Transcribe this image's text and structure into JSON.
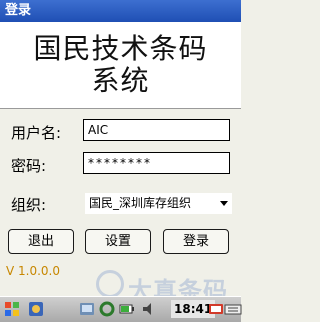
{
  "window": {
    "title": "登录"
  },
  "banner": {
    "line1": "国民技术条码",
    "line2": "系统"
  },
  "form": {
    "username_label": "用户名:",
    "username_value": "AIC",
    "password_label": "密码:",
    "password_value": "********",
    "org_label": "组织:",
    "org_value": "国民_深圳库存组织"
  },
  "buttons": {
    "exit": "退出",
    "settings": "设置",
    "login": "登录"
  },
  "version": "V 1.0.0.0",
  "watermark": "大真条码",
  "taskbar": {
    "time": "18:41"
  },
  "colors": {
    "titlebar": "#2a5bc2",
    "version_text": "#c78700"
  }
}
